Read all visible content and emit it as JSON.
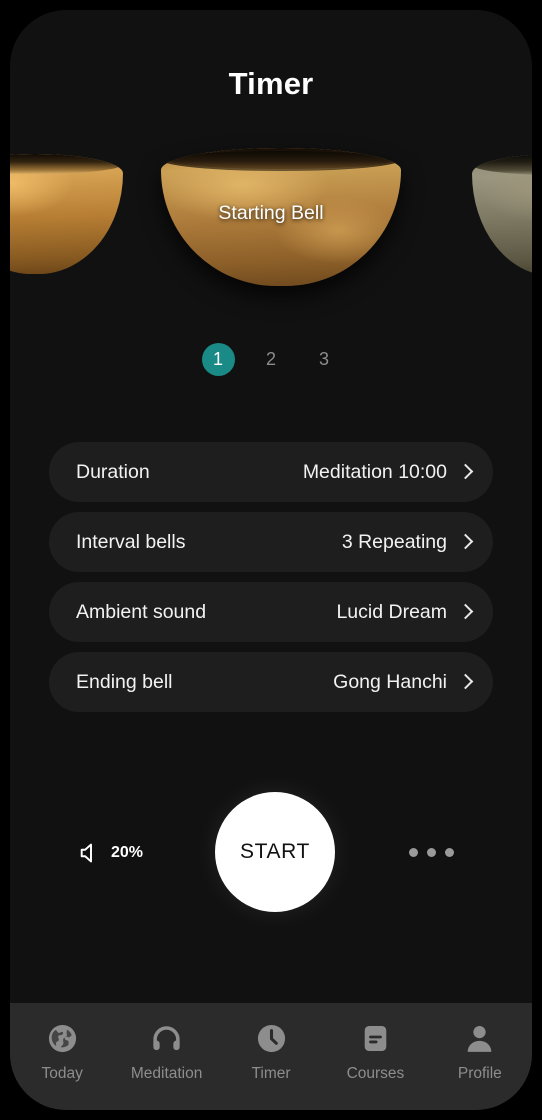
{
  "header": {
    "title": "Timer"
  },
  "carousel": {
    "center_label": "Starting Bell",
    "bowls": [
      {
        "name": "bowl-left",
        "tone": "golden"
      },
      {
        "name": "bowl-center",
        "tone": "bronze"
      },
      {
        "name": "bowl-right",
        "tone": "olive"
      }
    ]
  },
  "steps": {
    "active_index": 0,
    "active_color": "#1a8a87",
    "inactive_color": "#8c8c8c",
    "items": [
      {
        "label": "1"
      },
      {
        "label": "2"
      },
      {
        "label": "3"
      }
    ]
  },
  "settings": {
    "rows": [
      {
        "label": "Duration",
        "value": "Meditation 10:00",
        "chevron": "chevron-right-icon"
      },
      {
        "label": "Interval bells",
        "value": "3 Repeating",
        "chevron": "chevron-right-icon"
      },
      {
        "label": "Ambient sound",
        "value": "Lucid Dream",
        "chevron": "chevron-right-icon"
      },
      {
        "label": "Ending bell",
        "value": "Gong Hanchi",
        "chevron": "chevron-right-icon"
      }
    ]
  },
  "controls": {
    "volume": {
      "icon": "speaker-icon",
      "value": "20%"
    },
    "start": {
      "label": "START",
      "background": "#ffffff",
      "text_color": "#121212"
    },
    "more": {
      "icon": "more-horizontal-icon",
      "dots": 3
    }
  },
  "tab_bar": {
    "active": "Timer",
    "items": [
      {
        "label": "Today",
        "icon": "globe-icon"
      },
      {
        "label": "Meditation",
        "icon": "headphones-icon"
      },
      {
        "label": "Timer",
        "icon": "clock-icon"
      },
      {
        "label": "Courses",
        "icon": "book-icon"
      },
      {
        "label": "Profile",
        "icon": "person-icon"
      }
    ]
  }
}
